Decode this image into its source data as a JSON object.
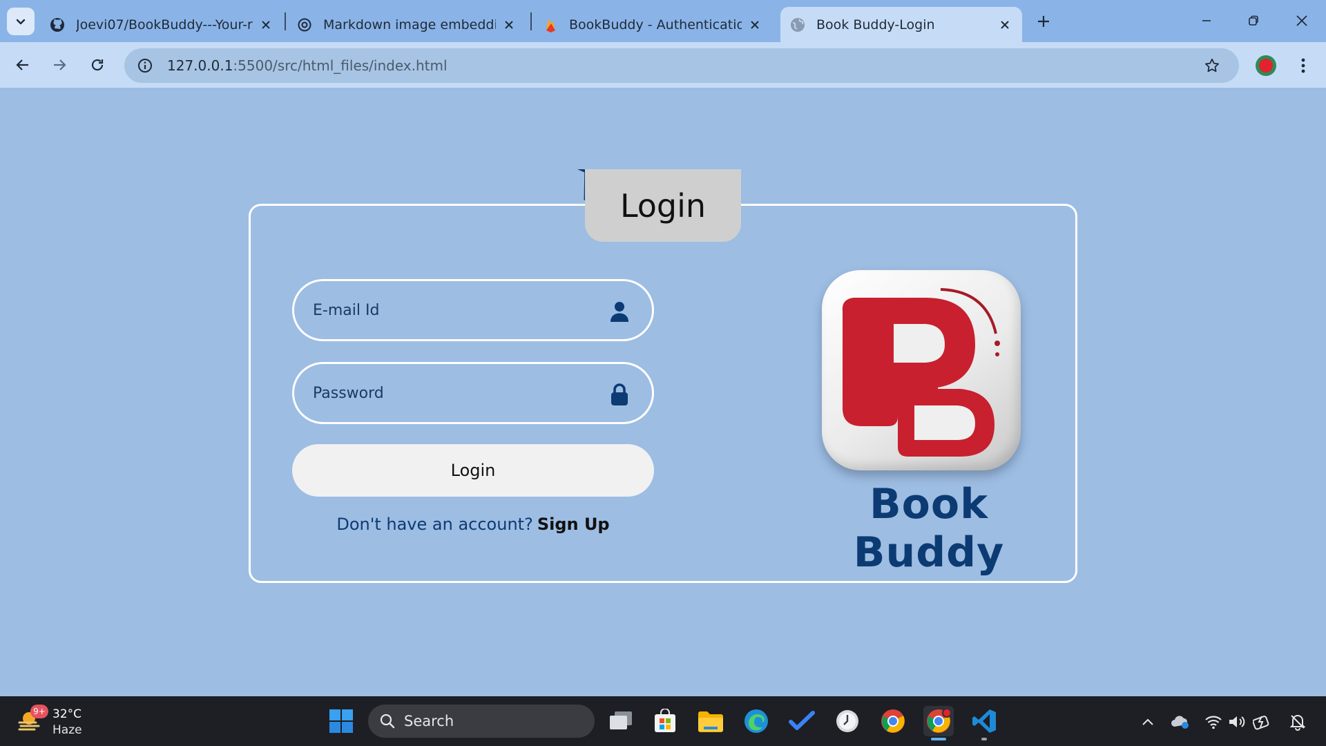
{
  "browser": {
    "tabs": [
      {
        "title": "Joevi07/BookBuddy---Your-rea",
        "favicon": "github-icon"
      },
      {
        "title": "Markdown image embedding",
        "favicon": "openai-icon"
      },
      {
        "title": "BookBuddy - Authentication - F",
        "favicon": "firebase-icon"
      },
      {
        "title": "Book Buddy-Login",
        "favicon": "globe-icon",
        "active": true
      }
    ],
    "url_host": "127.0.0.1",
    "url_path": ":5500/src/html_files/index.html",
    "accent": "#8ab4e8"
  },
  "page": {
    "heading": "Login",
    "email_placeholder": "E-mail Id",
    "password_placeholder": "Password",
    "login_button": "Login",
    "signup_prompt": "Don't have an account?",
    "signup_link": "Sign Up",
    "brand_name": "Book Buddy",
    "colors": {
      "background": "#9dbde3",
      "brand": "#0c3b73",
      "logo_red": "#c8202e"
    }
  },
  "taskbar": {
    "weather_temp": "32°C",
    "weather_condition": "Haze",
    "weather_badge": "9+",
    "search_label": "Search"
  }
}
